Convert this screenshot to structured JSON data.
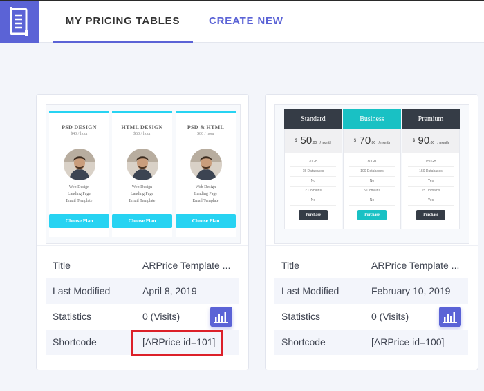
{
  "header": {
    "tabs": [
      {
        "label": "MY PRICING TABLES",
        "active": true
      },
      {
        "label": "CREATE NEW",
        "active": false
      }
    ],
    "logo_icon": "document-icon",
    "accent_color": "#5b63d6"
  },
  "cards": [
    {
      "template_preview": {
        "style": "profile-columns",
        "accent": "#27d3f2",
        "columns": [
          {
            "name": "PSD DESIGN",
            "price": "$40 / hour",
            "features": [
              "Web Design",
              "Landing Page",
              "Email Template"
            ],
            "button": "Choose Plan"
          },
          {
            "name": "HTML DESIGN",
            "price": "$60 / hour",
            "features": [
              "Web Design",
              "Landing Page",
              "Email Template"
            ],
            "button": "Choose Plan"
          },
          {
            "name": "PSD & HTML",
            "price": "$80 / hour",
            "features": [
              "Web Design",
              "Landing Page",
              "Email Template"
            ],
            "button": "Choose Plan"
          }
        ]
      },
      "info": {
        "title_label": "Title",
        "title_value": "ARPrice Template ...",
        "modified_label": "Last Modified",
        "modified_value": "April 8, 2019",
        "stats_label": "Statistics",
        "stats_value": "0 (Visits)",
        "shortcode_label": "Shortcode",
        "shortcode_value": "[ARPrice id=101]"
      },
      "shortcode_highlighted": true
    },
    {
      "template_preview": {
        "style": "header-columns",
        "columns": [
          {
            "name": "Standard",
            "currency": "$",
            "amount": "50",
            "decimal": ".00",
            "period": "/ month",
            "header_color": "#353c46",
            "button_color": "#353c46",
            "features": [
              "20GB",
              "15 Databases",
              "No",
              "2 Domains",
              "No"
            ],
            "button": "Purchase"
          },
          {
            "name": "Business",
            "currency": "$",
            "amount": "70",
            "decimal": ".00",
            "period": "/ month",
            "header_color": "#19c1c4",
            "button_color": "#19c1c4",
            "features": [
              "80GB",
              "100 Databases",
              "No",
              "5 Domains",
              "No"
            ],
            "button": "Purchase"
          },
          {
            "name": "Premium",
            "currency": "$",
            "amount": "90",
            "decimal": ".00",
            "period": "/ month",
            "header_color": "#353c46",
            "button_color": "#353c46",
            "features": [
              "150GB",
              "150 Databases",
              "Yes",
              "15 Domains",
              "Yes"
            ],
            "button": "Purchase"
          }
        ]
      },
      "info": {
        "title_label": "Title",
        "title_value": "ARPrice Template ...",
        "modified_label": "Last Modified",
        "modified_value": "February 10, 2019",
        "stats_label": "Statistics",
        "stats_value": "0 (Visits)",
        "shortcode_label": "Shortcode",
        "shortcode_value": "[ARPrice id=100]"
      },
      "shortcode_highlighted": false
    }
  ],
  "icons": {
    "stats_button": "bar-chart-icon"
  },
  "highlight_color": "#dc2029"
}
